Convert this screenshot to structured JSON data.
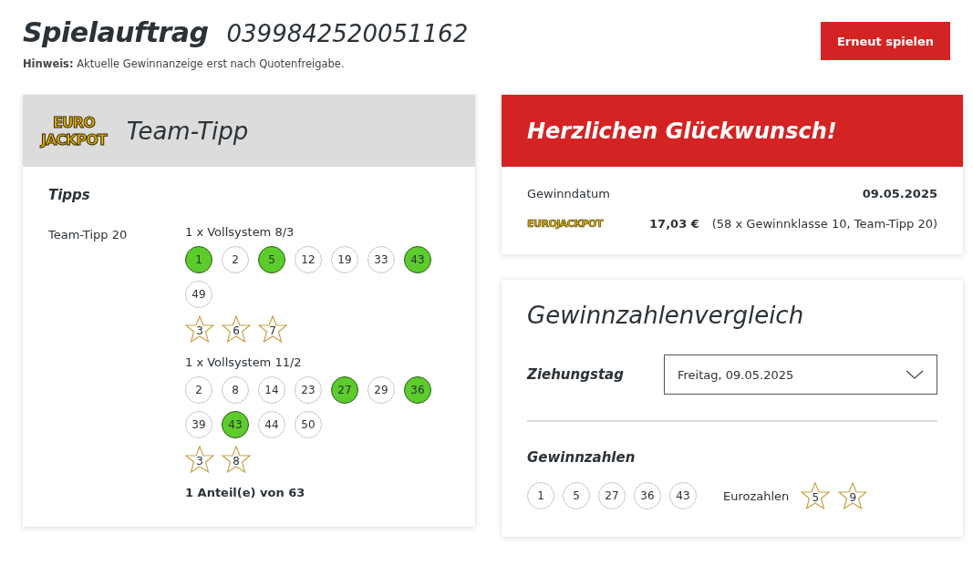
{
  "header": {
    "title": "Spielauftrag",
    "order_number": "0399842520051162",
    "button": "Erneut spielen",
    "hint_label": "Hinweis:",
    "hint_text": "Aktuelle Gewinnanzeige erst nach Quotenfreigabe."
  },
  "ticket": {
    "logo": [
      "EURO",
      "JACKPOT"
    ],
    "title": "Team-Tipp",
    "section_title": "Tipps",
    "tipp_label": "Team-Tipp 20",
    "systems": [
      {
        "label": "1 x Vollsystem 8/3",
        "numbers": [
          {
            "value": "1",
            "hit": true
          },
          {
            "value": "2",
            "hit": false
          },
          {
            "value": "5",
            "hit": true
          },
          {
            "value": "12",
            "hit": false
          },
          {
            "value": "19",
            "hit": false
          },
          {
            "value": "33",
            "hit": false
          },
          {
            "value": "43",
            "hit": true
          },
          {
            "value": "49",
            "hit": false
          }
        ],
        "euro_numbers": [
          "3",
          "6",
          "7"
        ]
      },
      {
        "label": "1 x Vollsystem 11/2",
        "numbers": [
          {
            "value": "2",
            "hit": false
          },
          {
            "value": "8",
            "hit": false
          },
          {
            "value": "14",
            "hit": false
          },
          {
            "value": "23",
            "hit": false
          },
          {
            "value": "27",
            "hit": true
          },
          {
            "value": "29",
            "hit": false
          },
          {
            "value": "36",
            "hit": true
          },
          {
            "value": "39",
            "hit": false
          },
          {
            "value": "43",
            "hit": true
          },
          {
            "value": "44",
            "hit": false
          },
          {
            "value": "50",
            "hit": false
          }
        ],
        "euro_numbers": [
          "3",
          "8"
        ]
      }
    ],
    "shares": "1 Anteil(e) von 63"
  },
  "win": {
    "title": "Herzlichen Glückwunsch!",
    "date_label": "Gewinndatum",
    "date": "09.05.2025",
    "logo": "EUROJACKPOT",
    "amount": "17,03 €",
    "detail": "(58 x Gewinnklasse 10, Team-Tipp 20)"
  },
  "comparison": {
    "title": "Gewinnzahlenvergleich",
    "draw_label": "Ziehungstag",
    "draw_value": "Freitag, 09.05.2025",
    "numbers_title": "Gewinnzahlen",
    "numbers": [
      "1",
      "5",
      "27",
      "36",
      "43"
    ],
    "euro_label": "Eurozahlen",
    "euro_numbers": [
      "5",
      "9"
    ]
  }
}
